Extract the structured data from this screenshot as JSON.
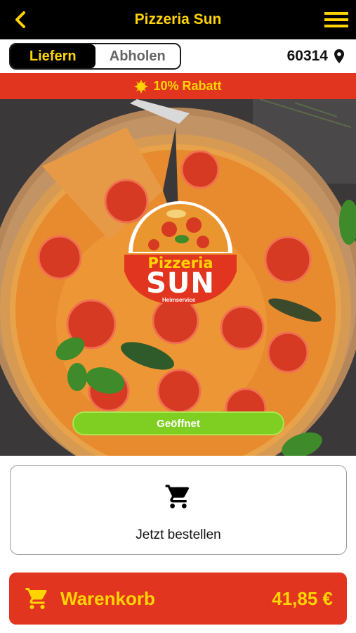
{
  "app": {
    "title": "Pizzeria Sun"
  },
  "icons": {
    "back": "chevron-left-icon",
    "menu": "hamburger-menu-icon",
    "location": "location-pin-icon",
    "discount": "sun-badge-icon",
    "order": "shopping-cart-icon",
    "cart": "shopping-cart-icon"
  },
  "delivery_mode": {
    "options": [
      "Liefern",
      "Abholen"
    ],
    "selected": "Liefern"
  },
  "location": {
    "zip": "60314"
  },
  "promo": {
    "text": "10% Rabatt"
  },
  "restaurant": {
    "logo_name": "Pizzeria",
    "logo_brand": "SUN",
    "logo_tagline": "Heimservice",
    "status": "Geöffnet"
  },
  "order_button": {
    "label": "Jetzt bestellen"
  },
  "cart": {
    "label": "Warenkorb",
    "total": "41,85 €"
  },
  "colors": {
    "accent_yellow": "#ffd400",
    "brand_red": "#e2351f",
    "status_green": "#7fcf22",
    "topbar_black": "#000000"
  }
}
